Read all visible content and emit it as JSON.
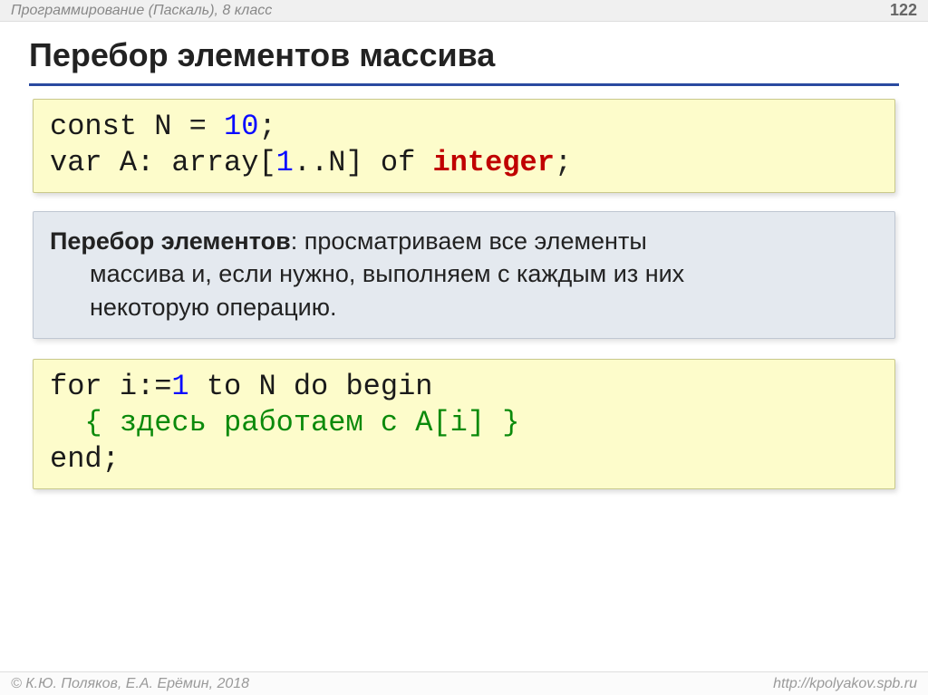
{
  "header": {
    "breadcrumb": "Программирование (Паскаль), 8 класс",
    "page_number": "122"
  },
  "title": "Перебор элементов массива",
  "code1": {
    "l1": {
      "a": "const N",
      "eq": "=",
      "b": "10",
      "c": ";"
    },
    "l2": {
      "a": "var A: array[",
      "b": "1",
      "c": "..N] of ",
      "d": "integer",
      "e": ";"
    }
  },
  "definition": {
    "term": "Перебор элементов",
    "line1_rest": ": просматриваем все элементы",
    "line2": "массива и, если нужно, выполняем с каждым из них",
    "line3": "некоторую операцию."
  },
  "code2": {
    "l1": {
      "a": "for i:=",
      "b": "1",
      "c": " to N do begin"
    },
    "l2": {
      "cmt": "  { здесь работаем с A[i] }"
    },
    "l3": {
      "a": "end;"
    }
  },
  "footer": {
    "copyright": "© К.Ю. Поляков, Е.А. Ерёмин, 2018",
    "url": "http://kpolyakov.spb.ru"
  }
}
